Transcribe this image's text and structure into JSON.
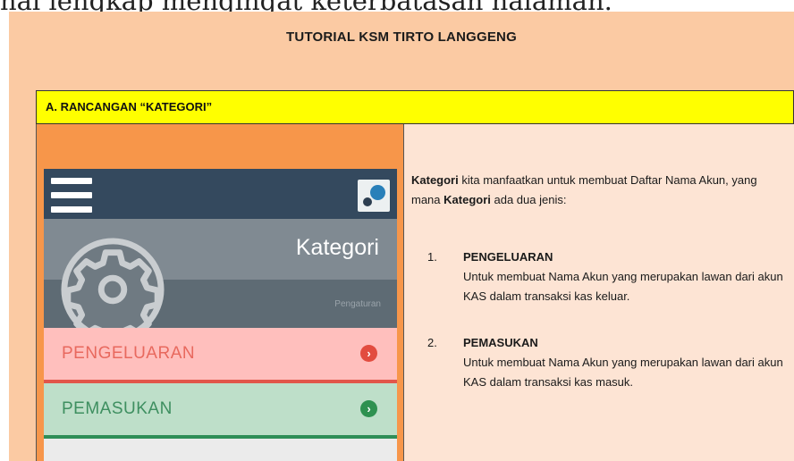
{
  "top_fragment": "hal lengkap mengingat keterbatasan halaman.",
  "title": "TUTORIAL KSM TIRTO LANGGENG",
  "section_heading": "A. RANCANGAN “KATEGORI”",
  "app": {
    "menu_icon": "hamburger-menu-icon",
    "logo_icon": "bubbles-logo-icon",
    "header_icon": "gear-icon",
    "header_title": "Kategori",
    "header_subtitle": "Pengaturan",
    "rows": [
      {
        "label": "PENGELUARAN",
        "chevron": "›",
        "color": "#e24c3f"
      },
      {
        "label": "PEMASUKAN",
        "chevron": "›",
        "color": "#2e9150"
      }
    ]
  },
  "description": {
    "intro_bold1": "Kategori",
    "intro_part1": " kita manfaatkan untuk membuat Daftar Nama Akun, yang mana ",
    "intro_bold2": "Kategori",
    "intro_part2": " ada dua jenis:",
    "items": [
      {
        "number": "1.",
        "heading": "PENGELUARAN",
        "text": "Untuk membuat Nama Akun yang merupakan lawan dari akun KAS dalam transaksi kas keluar."
      },
      {
        "number": "2.",
        "heading": "PEMASUKAN",
        "text": "Untuk membuat Nama Akun yang merupakan lawan dari akun KAS dalam transaksi kas masuk."
      }
    ]
  }
}
